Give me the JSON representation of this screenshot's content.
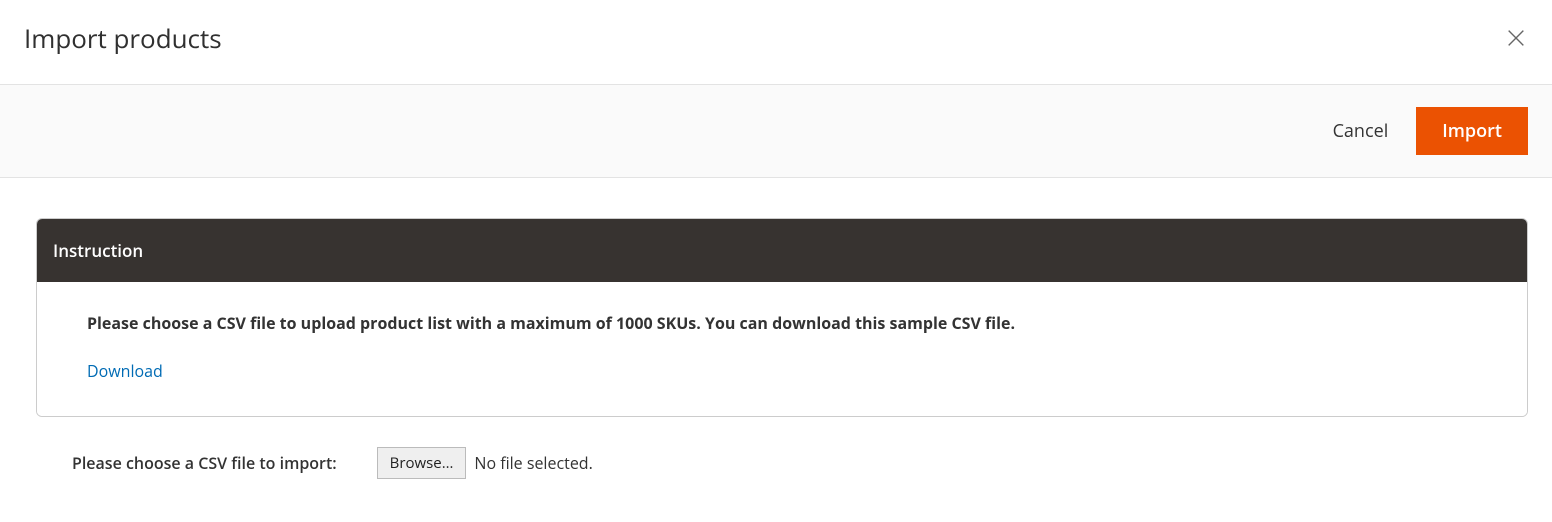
{
  "header": {
    "title": "Import products"
  },
  "toolbar": {
    "cancel_label": "Cancel",
    "import_label": "Import"
  },
  "instruction": {
    "header": "Instruction",
    "text": "Please choose a CSV file to upload product list with a maximum of 1000 SKUs. You can download this sample CSV file.",
    "download_label": "Download"
  },
  "file_upload": {
    "label": "Please choose a CSV file to import:",
    "browse_label": "Browse…",
    "status_text": "No file selected."
  }
}
